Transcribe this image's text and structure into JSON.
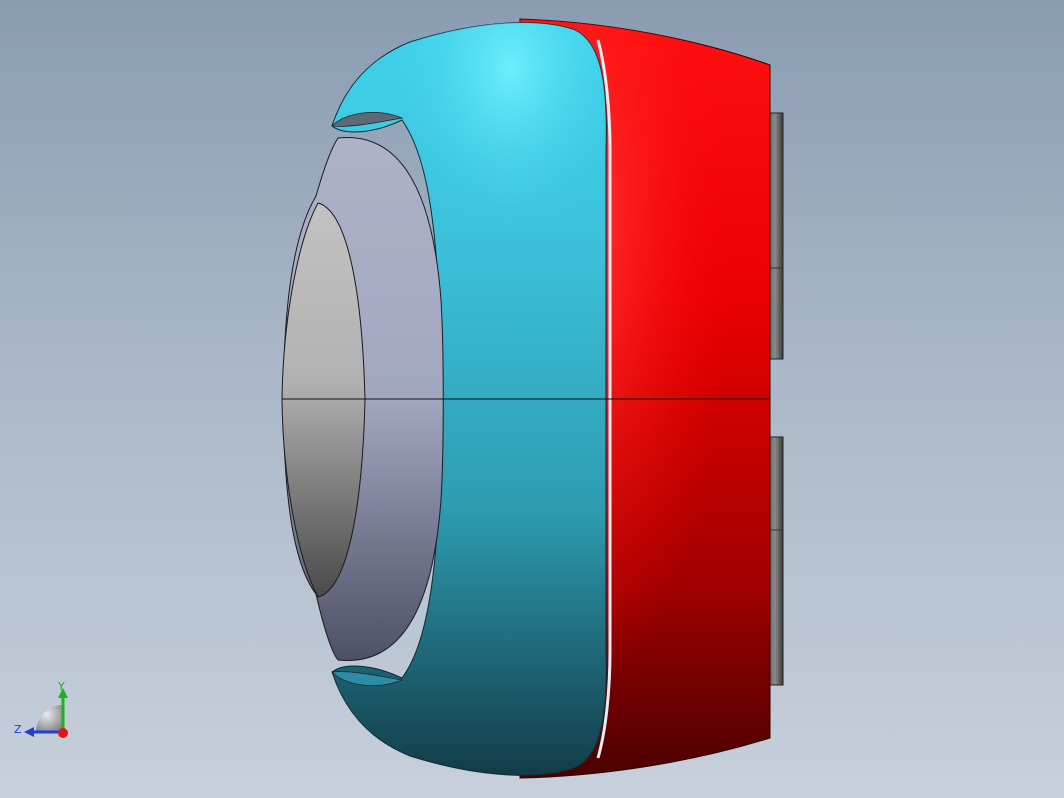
{
  "viewport": {
    "background_top": "#8a9cb2",
    "background_bottom": "#c7d0db"
  },
  "model": {
    "parts": [
      {
        "name": "rear-housing",
        "color": "#e00000"
      },
      {
        "name": "front-shell",
        "color": "#3bbfd6"
      },
      {
        "name": "inner-ring",
        "color": "#a9aec6"
      },
      {
        "name": "center-dome",
        "color": "#b4b4b4"
      },
      {
        "name": "side-blocks",
        "color": "#4a4a4a"
      }
    ]
  },
  "triad": {
    "y_label": "Y",
    "z_label": "Z",
    "y_color": "#1db11d",
    "z_color": "#1f3fd6",
    "x_color": "#e01515"
  }
}
